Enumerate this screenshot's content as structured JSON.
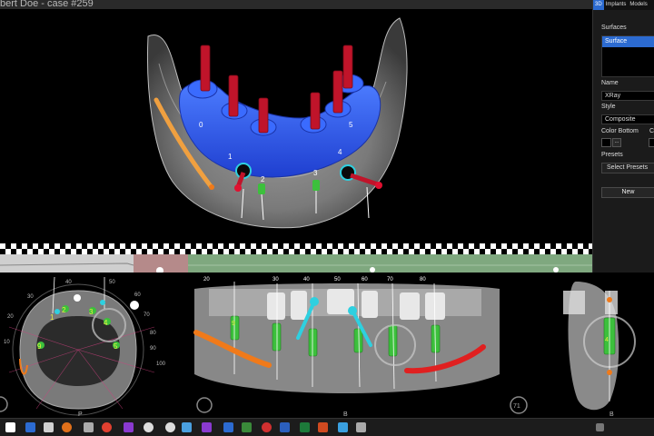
{
  "window": {
    "title": "bert Doe - case #259"
  },
  "right_panel": {
    "tabs": [
      "3D",
      "Implants",
      "Models"
    ],
    "surfaces_label": "Surfaces",
    "surfaces_items": [
      "Surface"
    ],
    "name_label": "Name",
    "name_value": "XRay",
    "style_label": "Style",
    "style_value": "Composite",
    "color_bottom_label": "Color Bottom",
    "color_top_label": "Co",
    "color_dots": "...",
    "presets_label": "Presets",
    "presets_value": "Select Presets",
    "new_button": "New"
  },
  "viewer_3d": {
    "implant_labels": [
      "0",
      "1",
      "2",
      "3",
      "4",
      "5"
    ]
  },
  "axial_view": {
    "tooth_labels": [
      "1",
      "2",
      "3",
      "4",
      "5",
      "9"
    ],
    "ruler_ticks": [
      "40",
      "50",
      "60",
      "70",
      "80",
      "90",
      "100",
      "30",
      "20",
      "10"
    ],
    "bottom_letter": "P"
  },
  "panoramic_view": {
    "scale_ticks": [
      "20",
      "30",
      "40",
      "50",
      "60",
      "70",
      "80"
    ],
    "implant_labels": [
      "9"
    ],
    "left_letter": "L",
    "right_letter": "L",
    "bottom_letter": "B"
  },
  "cross_view": {
    "bottom_letter": "B",
    "implant_labels": [
      "4"
    ],
    "circle_label": "71"
  },
  "colors": {
    "accent": "#2c6bd1",
    "implant_blue": "#2e5ef0",
    "implant_red": "#c0142a",
    "nerve_orange": "#f07a1a",
    "implant_green": "#3cc03c",
    "abutment_cyan": "#2ed0e0"
  }
}
